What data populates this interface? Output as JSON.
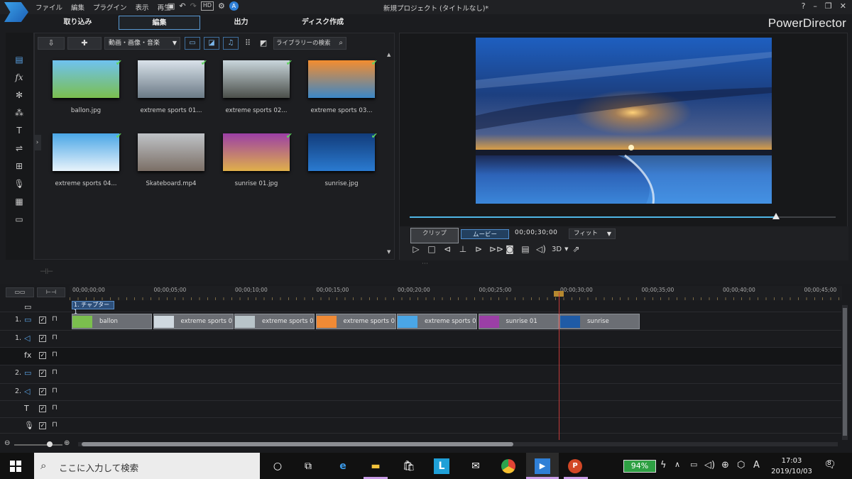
{
  "window": {
    "title": "新規プロジェクト (タイトルなし)*",
    "brand": "PowerDirector",
    "menu": [
      "ファイル",
      "編集",
      "プラグイン",
      "表示",
      "再生"
    ],
    "controls": [
      "?",
      "–",
      "❐",
      "✕"
    ]
  },
  "modes": [
    {
      "label": "取り込み",
      "active": false
    },
    {
      "label": "編集",
      "active": true
    },
    {
      "label": "出力",
      "active": false
    },
    {
      "label": "ディスク作成",
      "active": false
    }
  ],
  "library": {
    "filter": "動画・画像・音楽",
    "search_placeholder": "ライブラリーの検索",
    "items": [
      {
        "name": "ballon.jpg",
        "checked": true,
        "colors": [
          "#6fc2f0",
          "#7bbf4e"
        ]
      },
      {
        "name": "extreme sports 01...",
        "checked": true,
        "colors": [
          "#d9e2ea",
          "#6b7a86"
        ]
      },
      {
        "name": "extreme sports 02...",
        "checked": true,
        "colors": [
          "#c9d6dc",
          "#4b4f4a"
        ]
      },
      {
        "name": "extreme sports 03...",
        "checked": true,
        "colors": [
          "#f48d2f",
          "#3b87c7"
        ]
      },
      {
        "name": "extreme sports 04...",
        "checked": true,
        "colors": [
          "#4aa6e6",
          "#e8f3fb"
        ]
      },
      {
        "name": "Skateboard.mp4",
        "checked": false,
        "colors": [
          "#bfc3c7",
          "#7b6f66"
        ]
      },
      {
        "name": "sunrise 01.jpg",
        "checked": true,
        "colors": [
          "#9b3fa6",
          "#e0b04a"
        ]
      },
      {
        "name": "sunrise.jpg",
        "checked": true,
        "colors": [
          "#123c7a",
          "#2a7ad0"
        ]
      }
    ]
  },
  "preview": {
    "clip_label": "クリップ",
    "movie_label": "ムービー",
    "timecode": "00;00;30;00",
    "fit": "フィット",
    "mode_3d": "3D",
    "progress": 0.86
  },
  "timeline": {
    "ticks": [
      "00;00;00;00",
      "00;00;05;00",
      "00;00;10;00",
      "00;00;15;00",
      "00;00;20;00",
      "00;00;25;00",
      "00;00;30;00",
      "00;00;35;00",
      "00;00;40;00",
      "00;00;45;00"
    ],
    "chapter": "1. チャプター 1",
    "clips": [
      {
        "label": "ballon",
        "color": "#7bbf4e"
      },
      {
        "label": "extreme sports 0",
        "color": "#cfd8df"
      },
      {
        "label": "extreme sports 0",
        "color": "#b8c4c9"
      },
      {
        "label": "extreme sports 0",
        "color": "#f08a35"
      },
      {
        "label": "extreme sports 0",
        "color": "#4aa6e6"
      },
      {
        "label": "sunrise 01",
        "color": "#9b3fa6"
      },
      {
        "label": "sunrise",
        "color": "#1f5ba6"
      }
    ],
    "tracks": [
      {
        "num": "",
        "icon": "chapter-icon",
        "glyph": "▭"
      },
      {
        "num": "1.",
        "icon": "video-track-icon",
        "glyph": "▭"
      },
      {
        "num": "1.",
        "icon": "audio-track-icon",
        "glyph": "◁"
      },
      {
        "num": "",
        "icon": "fx-track-icon",
        "glyph": "fx"
      },
      {
        "num": "2.",
        "icon": "video-track-icon",
        "glyph": "▭"
      },
      {
        "num": "2.",
        "icon": "audio-track-icon",
        "glyph": "◁"
      },
      {
        "num": "",
        "icon": "title-track-icon",
        "glyph": "T"
      },
      {
        "num": "",
        "icon": "voice-track-icon",
        "glyph": "🎙"
      }
    ]
  },
  "taskbar": {
    "search_placeholder": "ここに入力して検索",
    "battery": "94%",
    "time": "17:03",
    "date": "2019/10/03",
    "notifications": "8",
    "ime": "A"
  }
}
